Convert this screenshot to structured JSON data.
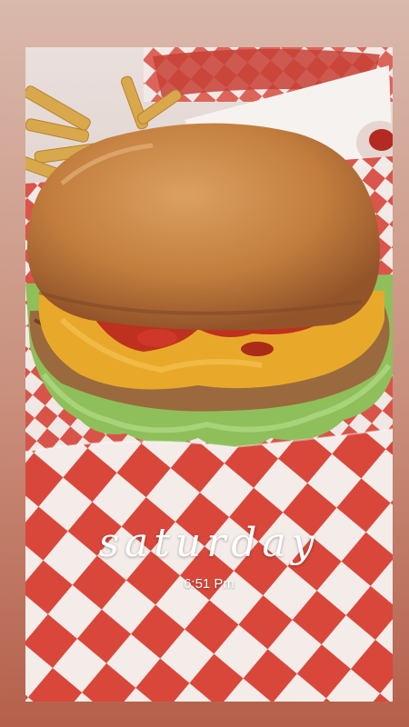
{
  "story": {
    "day_text": "saturday",
    "time_text": "6:51 Pm"
  },
  "colors": {
    "frame_top": "#d9b9ac",
    "frame_bottom": "#b5604b",
    "checker_red": "#d9473b",
    "checker_white": "#f4ece9",
    "bun": "#c98545",
    "cheese": "#e8a92a",
    "lettuce": "#8fbf5a",
    "ketchup": "#b8231d"
  }
}
